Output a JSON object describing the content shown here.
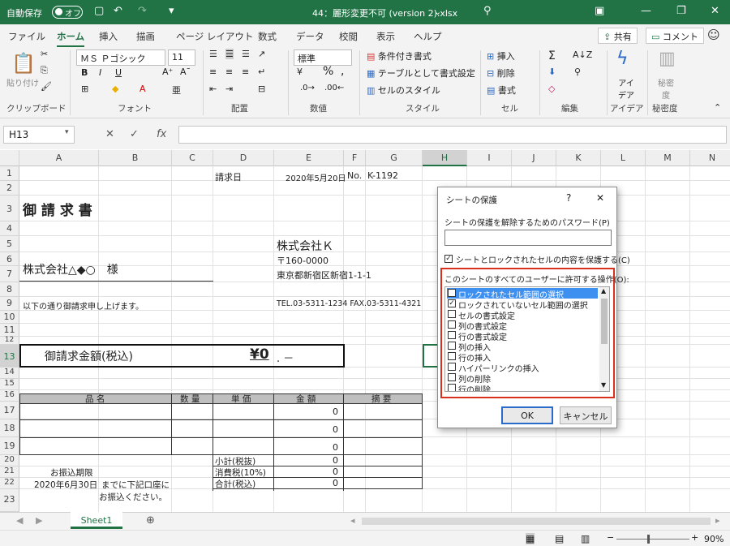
{
  "titlebar": {
    "autosave": "自動保存",
    "toggle": "オフ",
    "filename": "44：麗形変更不可 (version 2).xlsx",
    "dropdown": "⌄"
  },
  "tabs": [
    "ファイル",
    "ホーム",
    "挿入",
    "描画",
    "ページ レイアウト",
    "数式",
    "データ",
    "校閲",
    "表示",
    "ヘルプ"
  ],
  "share": "共有",
  "comment": "コメント",
  "ribbon": {
    "paste": "貼り付け",
    "clipboard": "クリップボード",
    "font_name": "ＭＳ Ｐゴシック",
    "font_size": "11",
    "font_group": "フォント",
    "bold": "B",
    "italic": "I",
    "underline": "U",
    "align_group": "配置",
    "number_format": "標準",
    "number_group": "数値",
    "cond_format": "条件付き書式",
    "table_format": "テーブルとして書式設定",
    "cell_style": "セルのスタイル",
    "style_group": "スタイル",
    "insert": "挿入",
    "delete": "削除",
    "format": "書式",
    "cells_group": "セル",
    "edit_group": "編集",
    "ideas": "アイ\nデア",
    "ideas_label": "アイデア",
    "ideas_group": "アイデア",
    "sensitivity": "秘密\n度",
    "sensitivity_group": "秘密度"
  },
  "formula": {
    "namebox": "H13",
    "fx": "fx"
  },
  "columns": [
    "A",
    "B",
    "C",
    "D",
    "E",
    "F",
    "G",
    "H",
    "I",
    "J",
    "K",
    "L",
    "M",
    "N"
  ],
  "rows": [
    "1",
    "2",
    "3",
    "4",
    "5",
    "6",
    "7",
    "8",
    "9",
    "10",
    "11",
    "12",
    "13",
    "14",
    "15",
    "16",
    "17",
    "18",
    "19",
    "20",
    "21",
    "22",
    "23"
  ],
  "sheet": {
    "d1": "請求日",
    "e1": "2020年5月20日",
    "f1": "No.",
    "g1": "K-1192",
    "a3": "御 請 求 書",
    "e5": "株式会社Ｋ",
    "e6": "〒160-0000",
    "e7": "東京都新宿区新宿1-1-1",
    "a7": "株式会社△◆○　様",
    "a9": "以下の通り御請求申し上げます。",
    "e9": "TEL.03-5311-1234 FAX.03-5311-4321",
    "amount_label": "御請求金額(税込)",
    "amount_value": "¥0",
    "amount_suffix": ". －",
    "hdr_item": "品 名",
    "hdr_qty": "数 量",
    "hdr_price": "単 価",
    "hdr_amount": "金 額",
    "hdr_note": "摘 要",
    "zero": "0",
    "subtotal": "小計(税抜)",
    "tax": "消費税(10%)",
    "total": "合計(税込)",
    "deadline": "お振込期限",
    "deadline_date": "2020年6月30日",
    "deadline_text": "までに下記口座に",
    "deadline_text2": "お振込ください。"
  },
  "sheettab": "Sheet1",
  "status": {
    "zoom": "90%"
  },
  "dialog": {
    "title": "シートの保護",
    "help": "?",
    "close": "✕",
    "password_label": "シートの保護を解除するためのパスワード(P)",
    "protect_label": "シートとロックされたセルの内容を保護する(C)",
    "allow_label": "このシートのすべてのユーザーに許可する操作(O):",
    "permissions": [
      {
        "label": "ロックされたセル範囲の選択",
        "checked": true
      },
      {
        "label": "ロックされていないセル範囲の選択",
        "checked": true
      },
      {
        "label": "セルの書式設定",
        "checked": false
      },
      {
        "label": "列の書式設定",
        "checked": false
      },
      {
        "label": "行の書式設定",
        "checked": false
      },
      {
        "label": "列の挿入",
        "checked": false
      },
      {
        "label": "行の挿入",
        "checked": false
      },
      {
        "label": "ハイパーリンクの挿入",
        "checked": false
      },
      {
        "label": "列の削除",
        "checked": false
      },
      {
        "label": "行の削除",
        "checked": false
      }
    ],
    "ok": "OK",
    "cancel": "キャンセル",
    "highlight_color": "#d9301e"
  }
}
